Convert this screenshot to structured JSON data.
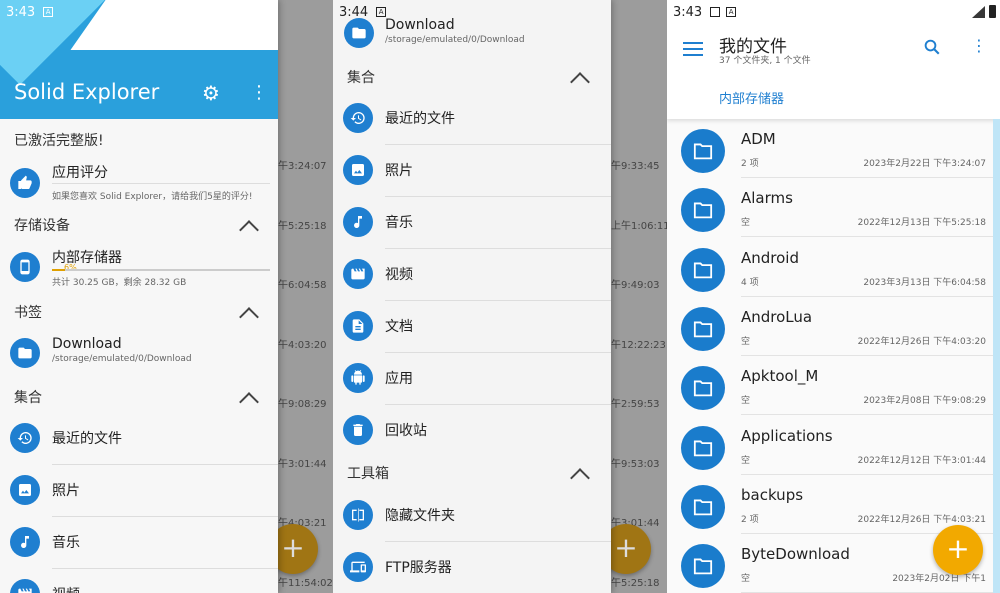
{
  "panel1": {
    "status": {
      "time": "3:43",
      "badge": "A"
    },
    "hero": {
      "title": "Solid Explorer"
    },
    "activated": "已激活完整版!",
    "rate": {
      "label": "应用评分",
      "desc": "如果您喜欢 Solid Explorer，请给我们5星的评分!"
    },
    "storage_header": "存储设备",
    "storage": {
      "label": "内部存储器",
      "percent": "6%",
      "detail": "共计 30.25 GB，剩余 28.32 GB",
      "fraction": 0.06
    },
    "bookmarks_header": "书签",
    "bookmark": {
      "label": "Download",
      "path": "/storage/emulated/0/Download"
    },
    "collections_header": "集合",
    "items": [
      "最近的文件",
      "照片",
      "音乐",
      "视频"
    ],
    "bg_times": [
      "午3:24:07",
      "午5:25:18",
      "午6:04:58",
      "午4:03:20",
      "午9:08:29",
      "午3:01:44",
      "午4:03:21",
      "午11:54:02"
    ]
  },
  "panel2": {
    "status": {
      "time": "3:44",
      "badge": "A"
    },
    "download": {
      "label": "Download",
      "path": "/storage/emulated/0/Download"
    },
    "collections_header": "集合",
    "items": [
      "最近的文件",
      "照片",
      "音乐",
      "视频",
      "文档",
      "应用",
      "回收站"
    ],
    "tools_header": "工具箱",
    "tools": [
      "隐藏文件夹",
      "FTP服务器"
    ],
    "bg_times": [
      "午9:33:45",
      "上午1:06:11",
      "午9:49:03",
      "午12:22:23",
      "午2:59:53",
      "午9:53:03",
      "午3:01:44",
      "午5:25:18"
    ]
  },
  "panel3": {
    "status": {
      "time": "3:43",
      "badge": "A"
    },
    "title": "我的文件",
    "subtitle": "37 个文件夹, 1 个文件",
    "breadcrumb": "内部存储器",
    "folders": [
      {
        "name": "ADM",
        "meta": "2 项",
        "date": "2023年2月22日 下午3:24:07"
      },
      {
        "name": "Alarms",
        "meta": "空",
        "date": "2022年12月13日 下午5:25:18"
      },
      {
        "name": "Android",
        "meta": "4 项",
        "date": "2023年3月13日 下午6:04:58"
      },
      {
        "name": "AndroLua",
        "meta": "空",
        "date": "2022年12月26日 下午4:03:20"
      },
      {
        "name": "Apktool_M",
        "meta": "空",
        "date": "2023年2月08日 下午9:08:29"
      },
      {
        "name": "Applications",
        "meta": "空",
        "date": "2022年12月12日 下午3:01:44"
      },
      {
        "name": "backups",
        "meta": "2 项",
        "date": "2022年12月26日 下午4:03:21"
      },
      {
        "name": "ByteDownload",
        "meta": "空",
        "date": "2023年2月02日 下午1"
      }
    ]
  },
  "colors": {
    "accent": "#1f7fd0",
    "fab": "#f2a900",
    "hero": "#2aa0dc"
  }
}
